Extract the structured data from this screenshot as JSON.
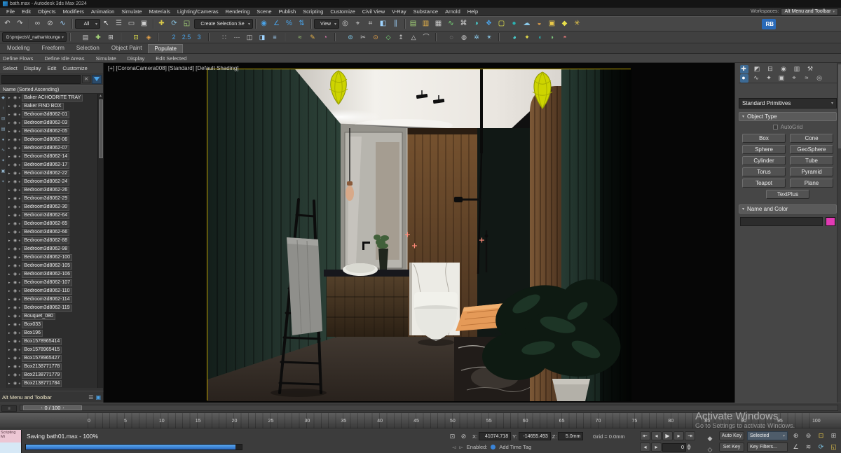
{
  "ui": {
    "dropdown_arrow": "▾"
  },
  "title_bar": {
    "title": "bath.max - Autodesk 3ds Max 2024"
  },
  "menu_bar": {
    "items": [
      "File",
      "Edit",
      "Objects",
      "Modifiers",
      "Animation",
      "Simulate",
      "Materials",
      "Lighting/Cameras",
      "Rendering",
      "Scene",
      "Publish",
      "Scripting",
      "Customize",
      "Civil View",
      "V-Ray",
      "Substance",
      "Arnold",
      "Help"
    ],
    "workspaces_label": "Workspaces:",
    "workspaces_value": "Alt Menu and Toolbar"
  },
  "toolbar_main": {
    "items": [
      {
        "name": "undo-icon",
        "glyph": "↶",
        "color": "#cfcfcf"
      },
      {
        "name": "redo-icon",
        "glyph": "↷",
        "color": "#cfcfcf"
      },
      {
        "name": "separator",
        "cls": "sep"
      },
      {
        "name": "select-and-link-icon",
        "glyph": "∞",
        "color": "#cfcfcf"
      },
      {
        "name": "unlink-selection-icon",
        "glyph": "⊘",
        "color": "#cfcfcf"
      },
      {
        "name": "bind-to-space-warp-icon",
        "glyph": "∿",
        "color": "#9fd4ff"
      },
      {
        "name": "separator",
        "cls": "sep"
      },
      {
        "name": "selection-filter-dropdown",
        "cls": "dd",
        "label": "All"
      },
      {
        "name": "select-object-icon",
        "glyph": "↖",
        "color": "#ececec"
      },
      {
        "name": "select-by-name-icon",
        "glyph": "☰",
        "color": "#cfcfcf"
      },
      {
        "name": "rectangular-selection-region-icon",
        "glyph": "▭",
        "color": "#cfcfcf"
      },
      {
        "name": "window-crossing-icon",
        "glyph": "▣",
        "color": "#cfcfcf"
      },
      {
        "name": "separator",
        "cls": "sep"
      },
      {
        "name": "select-and-move-icon",
        "glyph": "✚",
        "color": "#d8c84a"
      },
      {
        "name": "select-and-rotate-icon",
        "glyph": "⟳",
        "color": "#8ac8e8"
      },
      {
        "name": "select-and-scale-icon",
        "glyph": "◱",
        "color": "#a8d87a"
      },
      {
        "name": "named-selection-sets-field",
        "cls": "dd wide",
        "label": "Create Selection Se"
      },
      {
        "name": "separator",
        "cls": "sep"
      },
      {
        "name": "snaps-toggle-icon",
        "glyph": "◉",
        "color": "#4aa3e8"
      },
      {
        "name": "angle-snap-icon",
        "glyph": "∠",
        "color": "#4aa3e8"
      },
      {
        "name": "percent-snap-icon",
        "glyph": "%",
        "color": "#4aa3e8"
      },
      {
        "name": "spinner-snap-icon",
        "glyph": "⇅",
        "color": "#4aa3e8"
      },
      {
        "name": "separator",
        "cls": "sep"
      },
      {
        "name": "reference-coordinate-dropdown",
        "cls": "dd",
        "label": "View"
      },
      {
        "name": "use-pivot-point-icon",
        "glyph": "◎",
        "color": "#cfcfcf"
      },
      {
        "name": "select-and-manipulate-icon",
        "glyph": "⌖",
        "color": "#cfcfcf"
      },
      {
        "name": "keyboard-override-icon",
        "glyph": "⌗",
        "color": "#cfcfcf"
      },
      {
        "name": "mirror-icon",
        "glyph": "◧",
        "color": "#9fd4ff"
      },
      {
        "name": "align-icon",
        "glyph": "∥",
        "color": "#9fd4ff"
      },
      {
        "name": "separator",
        "cls": "sep"
      },
      {
        "name": "toggle-scene-explorer-icon",
        "glyph": "▤",
        "color": "#a8d87a"
      },
      {
        "name": "toggle-layer-explorer-icon",
        "glyph": "▥",
        "color": "#e8b44a"
      },
      {
        "name": "toggle-ribbon-icon",
        "glyph": "▦",
        "color": "#cfcfcf"
      },
      {
        "name": "curve-editor-icon",
        "glyph": "∿",
        "color": "#7ee87e"
      },
      {
        "name": "schematic-view-icon",
        "glyph": "⌘",
        "color": "#cfcfcf"
      },
      {
        "name": "material-editor-icon",
        "glyph": "◑",
        "color": "#4ae0e0"
      },
      {
        "name": "render-setup-icon",
        "glyph": "❖",
        "color": "#4aa3e8"
      },
      {
        "name": "rendered-frame-window-icon",
        "glyph": "▢",
        "color": "#e8e84a"
      },
      {
        "name": "render-production-icon",
        "glyph": "●",
        "color": "#2ab4b4"
      },
      {
        "name": "render-in-cloud-icon",
        "glyph": "☁",
        "color": "#8ac8e8"
      },
      {
        "name": "open-autodesk-app-icon",
        "glyph": "◒",
        "color": "#e8a44a"
      },
      {
        "name": "vray-frame-buffer-icon",
        "glyph": "▣",
        "color": "#e8c84a"
      },
      {
        "name": "vray-render-icon",
        "glyph": "◆",
        "color": "#e8e04a"
      },
      {
        "name": "corona-render-icon",
        "glyph": "✳",
        "color": "#e8c84a"
      },
      {
        "name": "spacer",
        "cls": "spacer"
      },
      {
        "name": "workspace-rb-badge",
        "cls": "badge",
        "label": "RB"
      }
    ]
  },
  "toolbar_secondary": {
    "items": [
      {
        "name": "project-path-dropdown",
        "cls": "dd path",
        "label": "D:\\projects\\f_nathan\\lounge"
      },
      {
        "name": "separator",
        "cls": "sep"
      },
      {
        "name": "layer-list-icon",
        "glyph": "▤",
        "color": "#cfcfcf"
      },
      {
        "name": "create-new-layer-icon",
        "glyph": "✚",
        "color": "#a8d87a"
      },
      {
        "name": "add-to-layer-icon",
        "glyph": "⊞",
        "color": "#cfcfcf"
      },
      {
        "name": "separator",
        "cls": "sep"
      },
      {
        "name": "isolate-selection-icon",
        "glyph": "⊡",
        "color": "#e8e84a"
      },
      {
        "name": "lock-selection-icon",
        "glyph": "◈",
        "color": "#e8a44a"
      },
      {
        "name": "separator",
        "cls": "sep"
      },
      {
        "name": "snaps-2d-icon",
        "glyph": "2",
        "color": "#4aa3e8"
      },
      {
        "name": "snaps-25d-icon",
        "glyph": "2.5",
        "color": "#4aa3e8"
      },
      {
        "name": "snaps-3d-icon",
        "glyph": "3",
        "color": "#4aa3e8"
      },
      {
        "name": "separator",
        "cls": "sep"
      },
      {
        "name": "array-tool-icon",
        "glyph": "∷",
        "color": "#cfcfcf"
      },
      {
        "name": "spacing-tool-icon",
        "glyph": "⋯",
        "color": "#cfcfcf"
      },
      {
        "name": "clone-icon",
        "glyph": "◫",
        "color": "#cfcfcf"
      },
      {
        "name": "mirror-tool-icon",
        "glyph": "◨",
        "color": "#9fd4ff"
      },
      {
        "name": "align-position-icon",
        "glyph": "≡",
        "color": "#9fd4ff"
      },
      {
        "name": "separator",
        "cls": "sep"
      },
      {
        "name": "select-similar-icon",
        "glyph": "≈",
        "color": "#a8d87a"
      },
      {
        "name": "paint-selection-icon",
        "glyph": "✎",
        "color": "#e8b44a"
      },
      {
        "name": "soft-selection-icon",
        "glyph": "◔",
        "color": "#e87ab4"
      },
      {
        "name": "separator",
        "cls": "sep"
      },
      {
        "name": "swift-loop-icon",
        "glyph": "⊜",
        "color": "#7ec8e8"
      },
      {
        "name": "cut-tool-icon",
        "glyph": "✂",
        "color": "#cfcfcf"
      },
      {
        "name": "weld-icon",
        "glyph": "⊙",
        "color": "#e8a44a"
      },
      {
        "name": "chamfer-icon",
        "glyph": "◇",
        "color": "#7ee87e"
      },
      {
        "name": "extrude-icon",
        "glyph": "↥",
        "color": "#cfcfcf"
      },
      {
        "name": "bevel-icon",
        "glyph": "△",
        "color": "#cfcfcf"
      },
      {
        "name": "bridge-icon",
        "glyph": "⌒",
        "color": "#cfcfcf"
      },
      {
        "name": "separator",
        "cls": "sep"
      },
      {
        "name": "hide-selected-icon",
        "glyph": "◌",
        "color": "#cfcfcf"
      },
      {
        "name": "unhide-all-icon",
        "glyph": "◍",
        "color": "#cfcfcf"
      },
      {
        "name": "freeze-selection-icon",
        "glyph": "✲",
        "color": "#8ac8e8"
      },
      {
        "name": "unfreeze-all-icon",
        "glyph": "✴",
        "color": "#8ac8e8"
      },
      {
        "name": "separator",
        "cls": "sep"
      },
      {
        "name": "material-override-icon",
        "glyph": "◕",
        "color": "#4ae0e0"
      },
      {
        "name": "light-lister-icon",
        "glyph": "✦",
        "color": "#e8e04a"
      },
      {
        "name": "render-last-icon",
        "glyph": "◖",
        "color": "#2ab4b4"
      },
      {
        "name": "environment-icon",
        "glyph": "◗",
        "color": "#7ec87e"
      },
      {
        "name": "exposure-control-icon",
        "glyph": "◓",
        "color": "#e87a7a"
      }
    ]
  },
  "ribbon": {
    "tabs": [
      {
        "name": "ribbon-tab-modeling",
        "label": "Modeling"
      },
      {
        "name": "ribbon-tab-freeform",
        "label": "Freeform"
      },
      {
        "name": "ribbon-tab-selection",
        "label": "Selection"
      },
      {
        "name": "ribbon-tab-object-paint",
        "label": "Object Paint"
      },
      {
        "name": "ribbon-tab-populate",
        "label": "Populate",
        "cls": "active"
      }
    ],
    "sub_items": [
      "Define Flows",
      "Define Idle Areas",
      "Simulate",
      "Display",
      "Edit Selected"
    ]
  },
  "scene_explorer": {
    "menus": [
      "Select",
      "Display",
      "Edit",
      "Customize"
    ],
    "search_clear": "✕",
    "header": "Name (Sorted Ascending)",
    "row_icons": {
      "eye": "◉",
      "node": "●"
    },
    "strip_icons": [
      {
        "name": "pin-explorer-icon",
        "glyph": "◆"
      },
      {
        "name": "auto-scroll-icon",
        "glyph": "↕"
      },
      {
        "name": "hierarchy-view-icon",
        "glyph": "⊟"
      },
      {
        "name": "layer-view-icon",
        "glyph": "▤"
      },
      {
        "name": "filter-geometry-icon",
        "glyph": "●"
      },
      {
        "name": "filter-shapes-icon",
        "glyph": "∿"
      },
      {
        "name": "filter-lights-icon",
        "glyph": "✦"
      },
      {
        "name": "filter-cameras-icon",
        "glyph": "▣"
      },
      {
        "name": "filter-helpers-icon",
        "glyph": "⌖"
      }
    ],
    "items": [
      {
        "caret": "▸",
        "label": "Baker ACHODRITE TRAY"
      },
      {
        "caret": "▸",
        "label": "Baker FIND BOX"
      },
      {
        "caret": "▸",
        "label": "Bedroom3d8062-01"
      },
      {
        "caret": "▸",
        "label": "Bedroom3d8062-03"
      },
      {
        "caret": "▸",
        "label": "Bedroom3d8062-05"
      },
      {
        "caret": "▸",
        "label": "Bedroom3d8062-06"
      },
      {
        "caret": "▸",
        "label": "Bedroom3d8062-07"
      },
      {
        "caret": "▸",
        "label": "Bedroom3d8062-14"
      },
      {
        "caret": "▸",
        "label": "Bedroom3d8062-17"
      },
      {
        "caret": "▸",
        "label": "Bedroom3d8062-22"
      },
      {
        "caret": "▸",
        "label": "Bedroom3d8062-24"
      },
      {
        "caret": "▸",
        "label": "Bedroom3d8062-26"
      },
      {
        "caret": "▸",
        "label": "Bedroom3d8062-29"
      },
      {
        "caret": "▸",
        "label": "Bedroom3d8062-30"
      },
      {
        "caret": "▸",
        "label": "Bedroom3d8062-64"
      },
      {
        "caret": "▸",
        "label": "Bedroom3d8062-65"
      },
      {
        "caret": "▸",
        "label": "Bedroom3d8062-66"
      },
      {
        "caret": "▸",
        "label": "Bedroom3d8062-88"
      },
      {
        "caret": "▸",
        "label": "Bedroom3d8062-98"
      },
      {
        "caret": "▸",
        "label": "Bedroom3d8062-100"
      },
      {
        "caret": "▸",
        "label": "Bedroom3d8062-105"
      },
      {
        "caret": "▸",
        "label": "Bedroom3d8062-106"
      },
      {
        "caret": "▸",
        "label": "Bedroom3d8062-107"
      },
      {
        "caret": "▸",
        "label": "Bedroom3d8062-110"
      },
      {
        "caret": "▸",
        "label": "Bedroom3d8062-114"
      },
      {
        "caret": "▸",
        "label": "Bedroom3d8062-119"
      },
      {
        "caret": "▸",
        "label": "Bouquet_080"
      },
      {
        "caret": "▸",
        "label": "Box033"
      },
      {
        "caret": "▸",
        "label": "Box196"
      },
      {
        "caret": "▸",
        "label": "Box1578965414"
      },
      {
        "caret": "▸",
        "label": "Box1578965415"
      },
      {
        "caret": "▸",
        "label": "Box1578965427"
      },
      {
        "caret": "▸",
        "label": "Box2138771778"
      },
      {
        "caret": "▸",
        "label": "Box2138771779"
      },
      {
        "caret": "▸",
        "label": "Box2138771784"
      }
    ]
  },
  "workspace_bar": {
    "label": "Alt Menu and Toolbar"
  },
  "viewport": {
    "label": "[+] [CoronaCamera008] [Standard] [Default Shading]"
  },
  "command_panel": {
    "tabs": [
      {
        "name": "create-tab",
        "glyph": "✚",
        "color": "#ececec",
        "cls": "cp-on"
      },
      {
        "name": "modify-tab",
        "glyph": "◩",
        "color": "#c8c8c8"
      },
      {
        "name": "hierarchy-tab",
        "glyph": "⊟",
        "color": "#c8c8c8"
      },
      {
        "name": "motion-tab",
        "glyph": "◉",
        "color": "#c8c8c8"
      },
      {
        "name": "display-tab",
        "glyph": "▥",
        "color": "#c8c8c8"
      },
      {
        "name": "utilities-tab",
        "glyph": "⚒",
        "color": "#c8c8c8"
      }
    ],
    "categories": [
      {
        "name": "geometry-category",
        "glyph": "●",
        "color": "#ffffff",
        "cls": "cp-on"
      },
      {
        "name": "shapes-category",
        "glyph": "∿",
        "color": "#c8c8c8"
      },
      {
        "name": "lights-category",
        "glyph": "✦",
        "color": "#c8c8c8"
      },
      {
        "name": "cameras-category",
        "glyph": "▣",
        "color": "#c8c8c8"
      },
      {
        "name": "helpers-category",
        "glyph": "⌖",
        "color": "#c8c8c8"
      },
      {
        "name": "space-warps-category",
        "glyph": "≈",
        "color": "#c8c8c8"
      },
      {
        "name": "systems-category",
        "glyph": "◎",
        "color": "#c8c8c8"
      }
    ],
    "dropdown_value": "Standard Primitives",
    "rollout_object_type": "Object Type",
    "autogrid_label": "AutoGrid",
    "primitives": [
      "Box",
      "Cone",
      "Sphere",
      "GeoSphere",
      "Cylinder",
      "Tube",
      "Torus",
      "Pyramid",
      "Teapot",
      "Plane",
      "TextPlus"
    ],
    "rollout_name_color": "Name and Color",
    "object_color": "#e23bb4"
  },
  "timeline": {
    "handle": "0 / 100",
    "ticks": [
      "0",
      "5",
      "10",
      "15",
      "20",
      "25",
      "30",
      "35",
      "40",
      "45",
      "50",
      "55",
      "60",
      "65",
      "70",
      "75",
      "80",
      "85",
      "90",
      "95",
      "100"
    ]
  },
  "status_bar": {
    "mini_listener_text": "Scripting Mi",
    "status_text": "Saving bath01.max  -  100%",
    "prompt_icons": [
      {
        "name": "isolate-status-icon",
        "glyph": "⊡",
        "color": "#c8c8c8"
      },
      {
        "name": "selection-lock-status-icon",
        "glyph": "⊘",
        "color": "#c8c8c8"
      }
    ],
    "coord_x_label": "X:",
    "coord_x": "41074.718",
    "coord_y_label": "Y:",
    "coord_y": "-14655.493",
    "coord_z_label": "Z:",
    "coord_z": "5.0mm",
    "grid_label": "Grid = 0.0mm",
    "enabled_label": "Enabled:",
    "add_time_tag": "Add Time Tag",
    "playback": [
      {
        "name": "go-to-start-button",
        "glyph": "⇤"
      },
      {
        "name": "previous-frame-button",
        "glyph": "◂"
      },
      {
        "name": "play-button",
        "glyph": "▶"
      },
      {
        "name": "next-frame-button",
        "glyph": "▸"
      },
      {
        "name": "go-to-end-button",
        "glyph": "⇥"
      }
    ],
    "frame_buttons": [
      {
        "name": "key-step-back-button",
        "glyph": "◂"
      },
      {
        "name": "key-step-forward-button",
        "glyph": "▸"
      }
    ],
    "frame_value": "0",
    "auto_key": "Auto Key",
    "selected_dd": "Selected",
    "set_key": "Set Key",
    "key_filters": "Key Filters...",
    "extra_icon_1": {
      "glyph": "◆"
    },
    "extra_icon_2": {
      "glyph": "◇"
    },
    "nav_icons": [
      {
        "name": "zoom-icon",
        "glyph": "⊕",
        "color": "#c8c8c8"
      },
      {
        "name": "zoom-all-icon",
        "glyph": "⊚",
        "color": "#c8c8c8"
      },
      {
        "name": "zoom-extents-icon",
        "glyph": "⊡",
        "color": "#e8c84a"
      },
      {
        "name": "zoom-region-icon",
        "glyph": "⊞",
        "color": "#c8c8c8"
      },
      {
        "name": "field-of-view-icon",
        "glyph": "∠",
        "color": "#c8c8c8"
      },
      {
        "name": "pan-icon",
        "glyph": "≋",
        "color": "#c8c8c8"
      },
      {
        "name": "orbit-icon",
        "glyph": "⟳",
        "color": "#7ec8e8"
      },
      {
        "name": "maximize-viewport-icon",
        "glyph": "◱",
        "color": "#e8c84a"
      }
    ]
  },
  "watermark": {
    "line1": "Activate Windows",
    "line2": "Go to Settings to activate Windows."
  },
  "colors": {
    "accent_blue": "#4aa3e8",
    "viewport_border": "#bfa300",
    "progress_blue": "#3a84d8",
    "object_color": "#e23bb4"
  }
}
